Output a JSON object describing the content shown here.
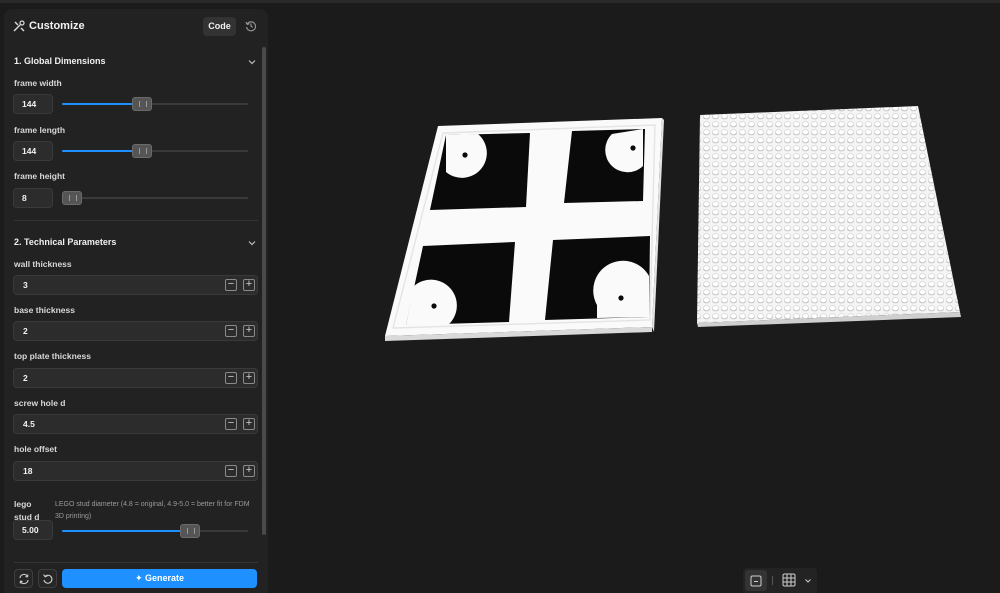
{
  "header": {
    "title": "Customize",
    "code_label": "Code",
    "icons": {
      "title": "customize-tools-icon",
      "history": "history-icon"
    }
  },
  "sections": [
    {
      "title": "1. Global Dimensions"
    },
    {
      "title": "2. Technical Parameters"
    }
  ],
  "sliders": [
    {
      "label": "frame width",
      "value": "144",
      "fraction": 0.42
    },
    {
      "label": "frame length",
      "value": "144",
      "fraction": 0.42
    },
    {
      "label": "frame height",
      "value": "8",
      "fraction": 0.0
    }
  ],
  "numbers": [
    {
      "label": "wall thickness",
      "value": "3"
    },
    {
      "label": "base thickness",
      "value": "2"
    },
    {
      "label": "top plate thickness",
      "value": "2"
    },
    {
      "label": "screw hole d",
      "value": "4.5"
    },
    {
      "label": "hole offset",
      "value": "18"
    }
  ],
  "lego": {
    "label": "lego stud d",
    "description": "LEGO stud diameter (4.8 = original, 4.9-5.0 = better fit for FDM 3D printing)",
    "value": "5.00",
    "fraction": 0.71
  },
  "footer": {
    "generate_label": "Generate",
    "icons": {
      "sync": "sync-icon",
      "reset": "reset-icon",
      "generate": "sparkle-icon"
    }
  },
  "viewport_tools": {
    "icons": [
      "frame-view-icon",
      "grid-icon",
      "chevron-down-icon"
    ]
  },
  "colors": {
    "accent": "#1e90ff",
    "panel": "#222222",
    "background": "#1b1b1b"
  }
}
